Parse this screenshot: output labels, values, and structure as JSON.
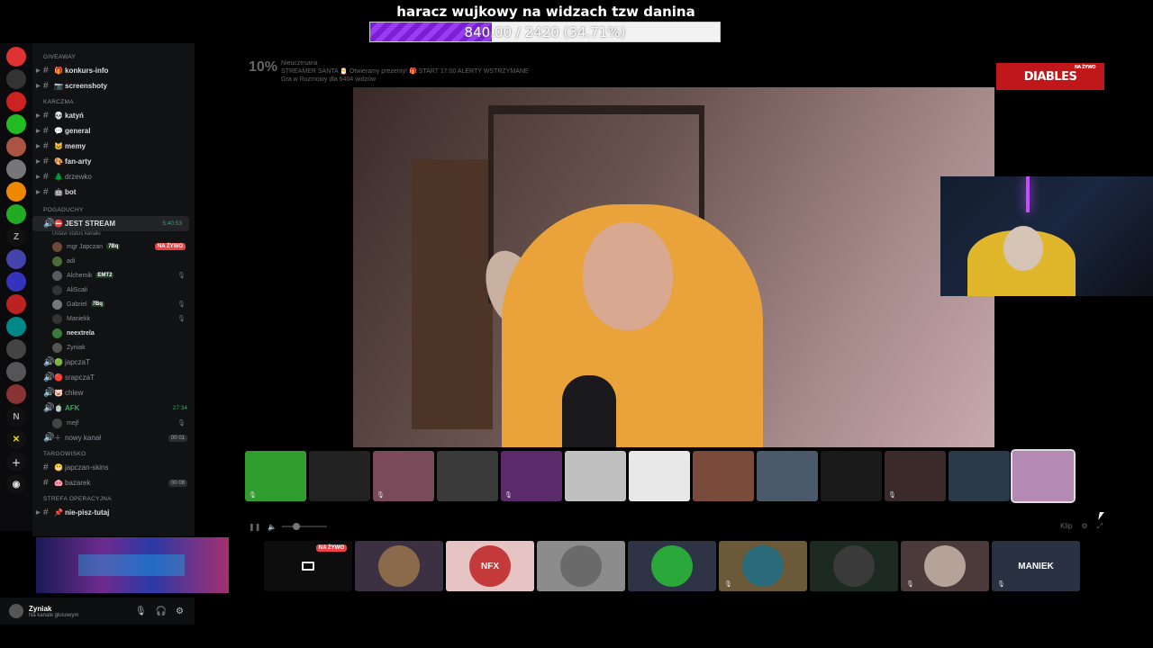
{
  "goal": {
    "title": "haracz wujkowy na widzach tzw danina",
    "progress_text": "840.00 / 2420 (34.71%)",
    "progress_fraction": 0.3471
  },
  "stream_info": {
    "percent": "10%",
    "status": "Nieuczesana",
    "line1": "STREAMER SANTA 🎅 Otwieramy prezenty! 🎁 START 17:00 ALERTY WSTRZYMANE",
    "line2": "Gra w Rozmowy dla 6404 widzów"
  },
  "brand": {
    "name": "DIABLES",
    "badge": "NA ŻYWO"
  },
  "sidebar": {
    "categories": [
      {
        "name": "GIVEAWAY",
        "channels": [
          {
            "emoji": "🎁",
            "name": "konkurs-info"
          },
          {
            "emoji": "📷",
            "name": "screenshoty"
          }
        ]
      },
      {
        "name": "KARCZMA",
        "channels": [
          {
            "emoji": "💀",
            "name": "katyń"
          },
          {
            "emoji": "💬",
            "name": "general"
          },
          {
            "emoji": "🐱",
            "name": "memy"
          },
          {
            "emoji": "🎨",
            "name": "fan-arty"
          },
          {
            "emoji": "🌲",
            "name": "drzewko"
          },
          {
            "emoji": "🤖",
            "name": "bot"
          }
        ]
      }
    ],
    "pogaduchy": {
      "name": "POGADUCHY",
      "active_channel": {
        "name": "JEST STREAM",
        "time": "5:40:53",
        "status": "Ustaw status kanału"
      },
      "users": [
        {
          "name": "mgr Japczan",
          "tag": "7Bq",
          "live": "NA ŻYWO",
          "color": "#6b4a3a"
        },
        {
          "name": "adi",
          "color": "#4a6b3a"
        },
        {
          "name": "Alchemik",
          "tag": "EMT2",
          "color": "#5a5a5a"
        },
        {
          "name": "AliScali",
          "color": "#333"
        },
        {
          "name": "Gabriel",
          "tag": "7Bq",
          "color": "#777"
        },
        {
          "name": "Maniekk",
          "color": "#333"
        },
        {
          "name": "neextrela",
          "color": "#3a7a3a"
        },
        {
          "name": "Zyniak",
          "color": "#555"
        }
      ],
      "voice_channels": [
        {
          "emoji": "🟢",
          "name": "japczaT"
        },
        {
          "emoji": "🔴",
          "name": "srapczaT"
        },
        {
          "emoji": "🐷",
          "name": "chlew"
        },
        {
          "emoji": "🍵",
          "name": "AFK",
          "time": "27:34"
        }
      ],
      "afk_user": "mejf",
      "extra_channel": {
        "name": "nowy kanał",
        "count": "00 01"
      }
    },
    "targowisko": {
      "name": "TARGOWISKO",
      "channels": [
        {
          "emoji": "😬",
          "name": "japczan-skins"
        },
        {
          "emoji": "🐽",
          "name": "bazarek",
          "count": "00 08"
        }
      ]
    },
    "strefa": {
      "name": "STREFA OPERACYJNA",
      "channel": "nie-pisz-tutaj"
    }
  },
  "userpanel": {
    "name": "Zyniak",
    "status": "Na kanale głosowym"
  },
  "controls": {
    "clip": "Klip"
  },
  "tiles": [
    {
      "label": "",
      "color": "#0d0d0d",
      "live": "NA ŻYWO",
      "screen": true
    },
    {
      "label": "",
      "color": "#3b3142",
      "avcolor": "#8a6a4a"
    },
    {
      "label": "NFX",
      "color": "#e7c4c4",
      "avcolor": "#c43a3a"
    },
    {
      "label": "",
      "color": "#8c8c8c",
      "avcolor": "#6a6a6a"
    },
    {
      "label": "",
      "color": "#2e3446",
      "avcolor": "#2aa83a"
    },
    {
      "label": "",
      "color": "#6a5a3a",
      "avcolor": "#2a6a7a"
    },
    {
      "label": "",
      "color": "#1d2a22",
      "avcolor": "#3a3a3a"
    },
    {
      "label": "",
      "color": "#4a3a3a",
      "avcolor": "#b5a39a"
    },
    {
      "label": "MANIEK",
      "color": "#2a3142",
      "avcolor": "#2a3142"
    }
  ],
  "thumbs": [
    "#2f9e2f",
    "#222",
    "#7a4a5a",
    "#3a3a3a",
    "#5a2a6a",
    "#c0c0c0",
    "#e8e8e8",
    "#7a4a3a",
    "#4a5a6a",
    "#1a1a1a",
    "#3a2a2a",
    "#2a3a4a",
    "#b48ab4"
  ]
}
